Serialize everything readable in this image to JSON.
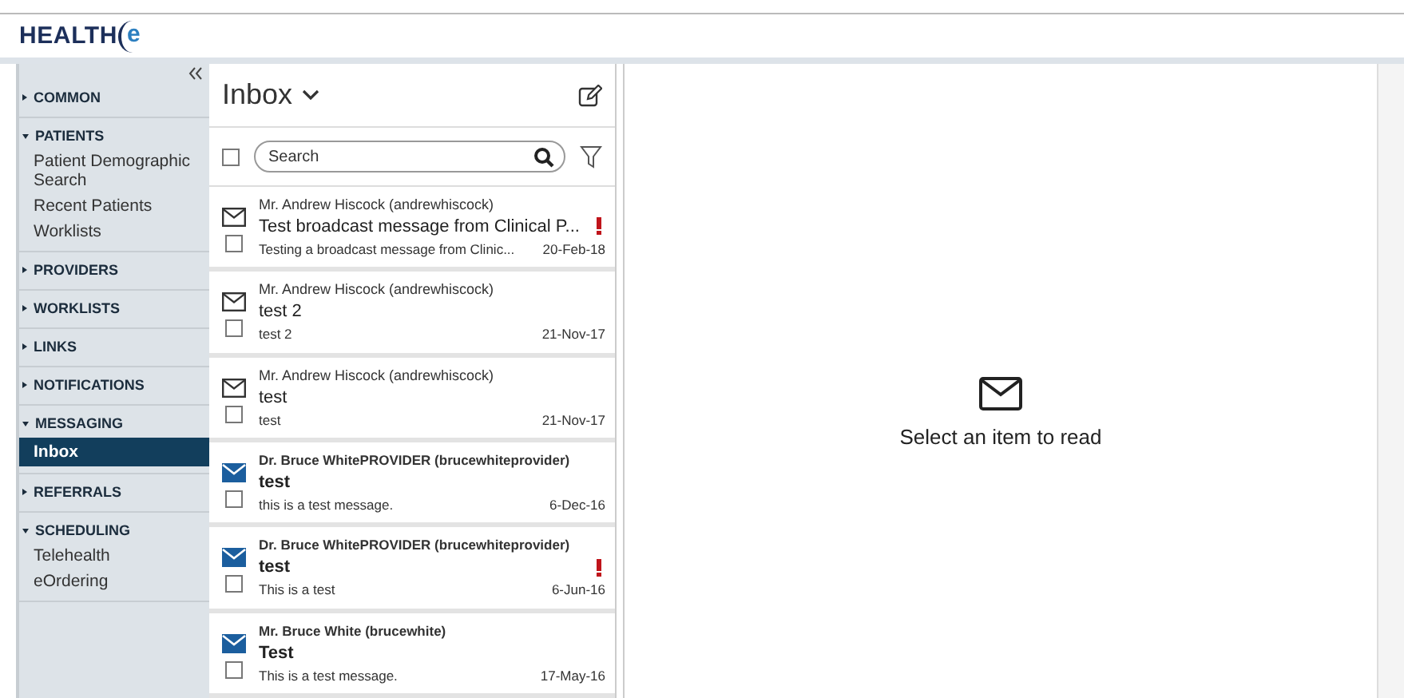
{
  "logo": {
    "text": "HEALTH",
    "mark": "e"
  },
  "sidebar": {
    "sections": [
      {
        "label": "COMMON",
        "expanded": false
      },
      {
        "label": "PATIENTS",
        "expanded": true,
        "items": [
          {
            "label": "Patient Demographic Search",
            "selected": false
          },
          {
            "label": "Recent Patients",
            "selected": false
          },
          {
            "label": "Worklists",
            "selected": false
          }
        ]
      },
      {
        "label": "PROVIDERS",
        "expanded": false
      },
      {
        "label": "WORKLISTS",
        "expanded": false
      },
      {
        "label": "LINKS",
        "expanded": false
      },
      {
        "label": "NOTIFICATIONS",
        "expanded": false
      },
      {
        "label": "MESSAGING",
        "expanded": true,
        "items": [
          {
            "label": "Inbox",
            "selected": true
          }
        ]
      },
      {
        "label": "REFERRALS",
        "expanded": false
      },
      {
        "label": "SCHEDULING",
        "expanded": true,
        "items": [
          {
            "label": "Telehealth",
            "selected": false
          },
          {
            "label": "eOrdering",
            "selected": false
          }
        ]
      }
    ]
  },
  "inbox": {
    "title": "Inbox",
    "select_all": {
      "checked": false
    },
    "search": {
      "placeholder": "Search"
    },
    "messages": [
      {
        "sender": "Mr. Andrew Hiscock (andrewhiscock)",
        "subject": "Test broadcast message from Clinical P...",
        "preview": "Testing a broadcast message from Clinic...",
        "date": "20-Feb-18",
        "unread": false,
        "important": true,
        "checked": false
      },
      {
        "sender": "Mr. Andrew Hiscock (andrewhiscock)",
        "subject": "test 2",
        "preview": "test 2",
        "date": "21-Nov-17",
        "unread": false,
        "important": false,
        "checked": false
      },
      {
        "sender": "Mr. Andrew Hiscock (andrewhiscock)",
        "subject": "test",
        "preview": "test",
        "date": "21-Nov-17",
        "unread": false,
        "important": false,
        "checked": false
      },
      {
        "sender": "Dr. Bruce WhitePROVIDER (brucewhiteprovider)",
        "subject": "test",
        "preview": "this is a test message.",
        "date": "6-Dec-16",
        "unread": true,
        "important": false,
        "checked": false
      },
      {
        "sender": "Dr. Bruce WhitePROVIDER (brucewhiteprovider)",
        "subject": "test",
        "preview": "This is a test",
        "date": "6-Jun-16",
        "unread": true,
        "important": true,
        "checked": false
      },
      {
        "sender": "Mr. Bruce White (brucewhite)",
        "subject": "Test",
        "preview": "This is a test message.",
        "date": "17-May-16",
        "unread": true,
        "important": false,
        "checked": false
      }
    ]
  },
  "reading_pane": {
    "empty_text": "Select an item to read"
  }
}
